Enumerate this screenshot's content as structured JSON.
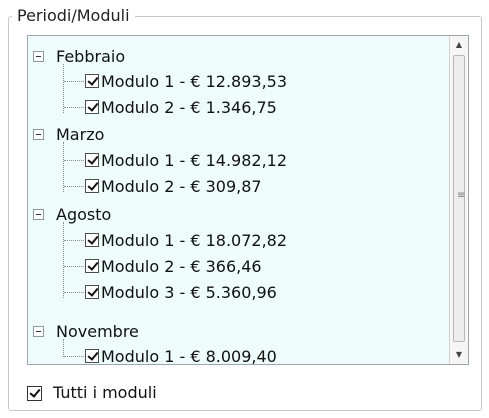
{
  "groupbox": {
    "caption": "Periodi/Moduli"
  },
  "tree": {
    "groups": [
      {
        "label": "Febbraio",
        "children": [
          {
            "label": "Modulo 1 - € 12.893,53",
            "checked": true
          },
          {
            "label": "Modulo 2 - € 1.346,75",
            "checked": true
          }
        ]
      },
      {
        "label": "Marzo",
        "children": [
          {
            "label": "Modulo 1 - € 14.982,12",
            "checked": true
          },
          {
            "label": "Modulo 2 - € 309,87",
            "checked": true
          }
        ]
      },
      {
        "label": "Agosto",
        "children": [
          {
            "label": "Modulo 1 - € 18.072,82",
            "checked": true
          },
          {
            "label": "Modulo 2 - € 366,46",
            "checked": true
          },
          {
            "label": "Modulo 3 - € 5.360,96",
            "checked": true
          }
        ]
      },
      {
        "label": "Novembre",
        "children": [
          {
            "label": "Modulo 1 - € 8.009,40",
            "checked": true
          }
        ]
      }
    ]
  },
  "footer": {
    "checkbox_label": "Tutti i moduli",
    "checked": true
  },
  "colors": {
    "tree_background": "#eefcfb",
    "border": "#9da6b0"
  }
}
